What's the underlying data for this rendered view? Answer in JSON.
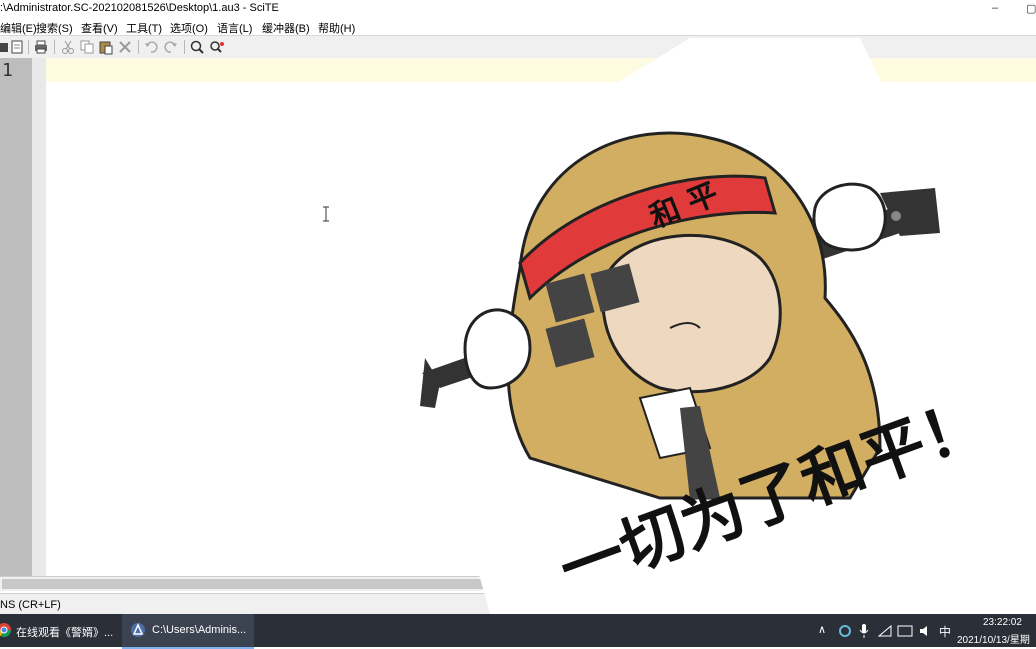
{
  "window": {
    "title": ":\\Administrator.SC-202102081526\\Desktop\\1.au3 - SciTE",
    "minimize_glyph": "–",
    "restore_glyph": "▢"
  },
  "menu": [
    "编辑(E)",
    "搜索(S)",
    "查看(V)",
    "工具(T)",
    "选项(O)",
    "语言(L)",
    "缓冲器(B)",
    "帮助(H)"
  ],
  "editor": {
    "line_numbers": [
      "1"
    ]
  },
  "status": {
    "text": "NS (CR+LF)"
  },
  "taskbar": {
    "items": [
      {
        "label": "在线观看《警婿》..."
      },
      {
        "label": "C:\\Users\\Adminis..."
      }
    ],
    "tray_ime": "中",
    "clock_time": "23:22:02",
    "clock_date": "2021/10/13/星期"
  },
  "sticker": {
    "headband_text": "和 平",
    "caption": "一切为了和平！"
  },
  "colors": {
    "hood": "#d2ae62",
    "headband": "#e03a3a",
    "taskbar": "#2b2f38",
    "caret_line": "#fffbe0"
  }
}
